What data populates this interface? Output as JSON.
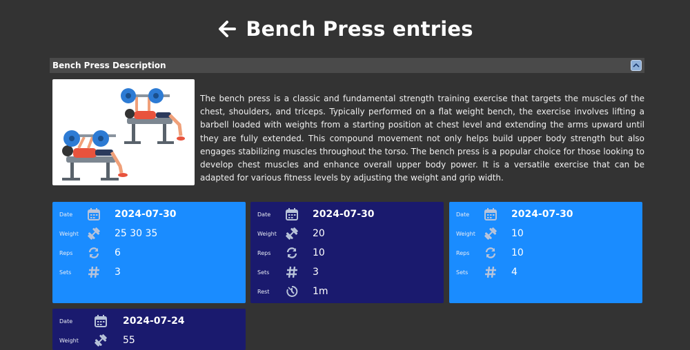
{
  "header": {
    "title": "Bench Press entries",
    "back_icon": "arrow-left-icon"
  },
  "description": {
    "panel_title": "Bench Press Description",
    "collapse_icon": "chevron-up-icon",
    "image_alt": "bench-press-illustration",
    "text": "The bench press is a classic and fundamental strength training exercise that targets the muscles of the chest, shoulders, and triceps. Typically performed on a flat weight bench, the exercise involves lifting a barbell loaded with weights from a starting position at chest level and extending the arms upward until they are fully extended. This compound movement not only helps build upper body strength but also engages stabilizing muscles throughout the torso. The bench press is a popular choice for those looking to develop chest muscles and enhance overall upper body power. It is a versatile exercise that can be adapted for various fitness levels by adjusting the weight and grip width."
  },
  "labels": {
    "date": "Date",
    "weight": "Weight",
    "reps": "Reps",
    "sets": "Sets",
    "rest": "Rest"
  },
  "entries": [
    {
      "date": "2024-07-30",
      "weight": "25 30 35",
      "reps": "6",
      "sets": "3"
    },
    {
      "date": "2024-07-30",
      "weight": "20",
      "reps": "10",
      "sets": "3",
      "rest": "1m"
    },
    {
      "date": "2024-07-30",
      "weight": "10",
      "reps": "10",
      "sets": "4"
    },
    {
      "date": "2024-07-24",
      "weight": "55"
    }
  ],
  "colors": {
    "card_blue": "#1a8cff",
    "card_navy": "#1a1a6e",
    "background": "#333333"
  }
}
